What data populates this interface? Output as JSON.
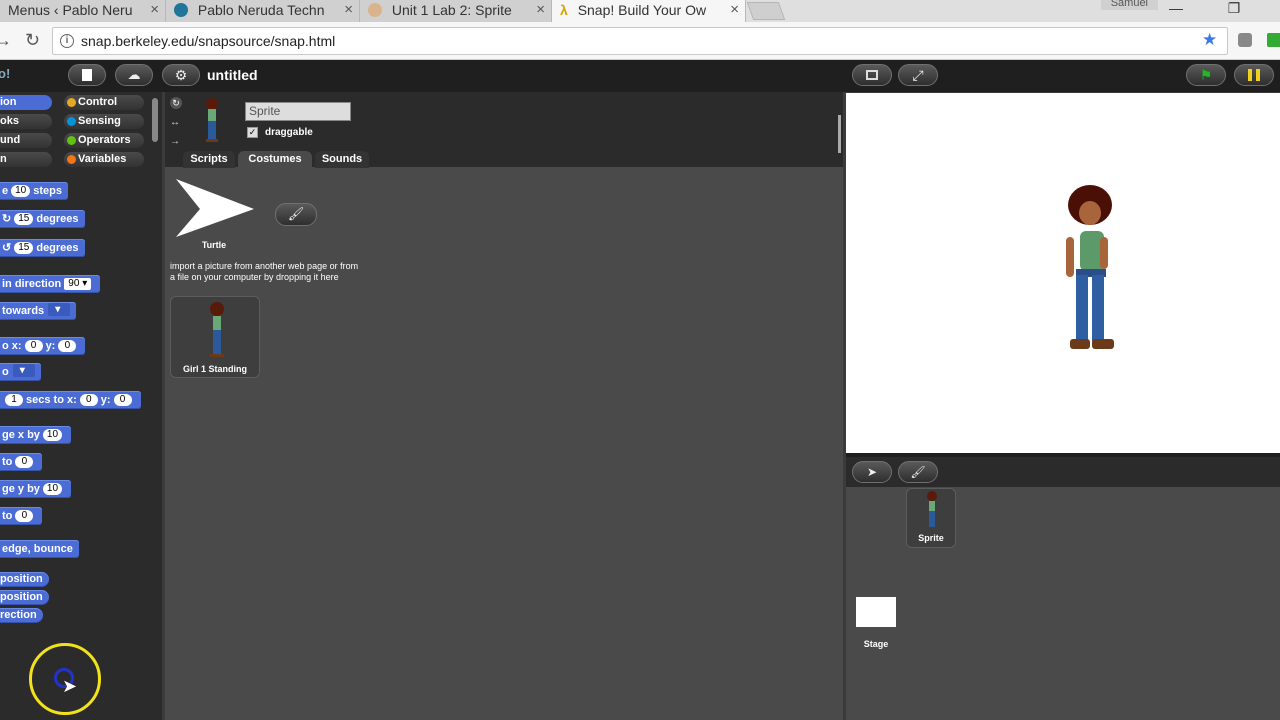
{
  "browser": {
    "tabs": [
      {
        "title": "Menus ‹ Pablo Neru",
        "icon_color": "#8a8a8a"
      },
      {
        "title": "Pablo Neruda Techn",
        "icon_color": "#21759b"
      },
      {
        "title": "Unit 1 Lab 2: Sprite",
        "icon_color": "#c86"
      },
      {
        "title": "Snap! Build Your Ow",
        "icon_color": "#d8a200"
      }
    ],
    "close_glyph": "×",
    "user": "Samuel",
    "url": "snap.berkeley.edu/snapsource/snap.html"
  },
  "snap": {
    "project_title": "untitled",
    "categories": [
      "Motion",
      "Looks",
      "Sound",
      "Pen",
      "Control",
      "Sensing",
      "Operators",
      "Variables"
    ],
    "categories_visible": [
      "ion",
      "oks",
      "und",
      "n",
      "Control",
      "Sensing",
      "Operators",
      "Variables"
    ],
    "blocks": {
      "move": {
        "pre": "e",
        "val": "10",
        "post": "steps"
      },
      "turn_cw": {
        "val": "15",
        "post": "degrees"
      },
      "turn_ccw": {
        "val": "15",
        "post": "degrees"
      },
      "point_dir": {
        "text": "in direction",
        "val": "90"
      },
      "point_towards": {
        "text": "towards"
      },
      "goto_xy": {
        "pre": "o x:",
        "x": "0",
        "ylabel": "y:",
        "y": "0"
      },
      "goto": {
        "pre": "o"
      },
      "glide": {
        "secs": "1",
        "text": "secs to x:",
        "x": "0",
        "ylabel": "y:",
        "y": "0"
      },
      "change_x": {
        "text": "ge x by",
        "val": "10"
      },
      "set_x": {
        "text": "to",
        "val": "0"
      },
      "change_y": {
        "text": "ge y by",
        "val": "10"
      },
      "set_y": {
        "text": "to",
        "val": "0"
      },
      "bounce": {
        "text": "edge, bounce"
      },
      "xpos": {
        "text": "position"
      },
      "ypos": {
        "text": "position"
      },
      "direction": {
        "text": "rection"
      }
    },
    "sprite": {
      "name": "Sprite",
      "draggable_label": "draggable",
      "draggable_checked": "✓"
    },
    "tabs": {
      "scripts": "Scripts",
      "costumes": "Costumes",
      "sounds": "Sounds"
    },
    "costumes": {
      "turtle_label": "Turtle",
      "import_hint_1": "import a picture from another web page or from",
      "import_hint_2": "a file on your computer by dropping it here",
      "items": [
        {
          "name": "Girl 1 Standing"
        }
      ]
    },
    "corral": {
      "sprites": [
        {
          "name": "Sprite"
        }
      ],
      "stage_label": "Stage"
    }
  },
  "colors": {
    "motion": "#4a6cd4",
    "looks": "#8f56e3",
    "sound": "#cf4ad9",
    "pen": "#00a178",
    "control": "#e6a822",
    "sensing": "#0494dc",
    "operators": "#62c213",
    "variables": "#f3761d"
  }
}
